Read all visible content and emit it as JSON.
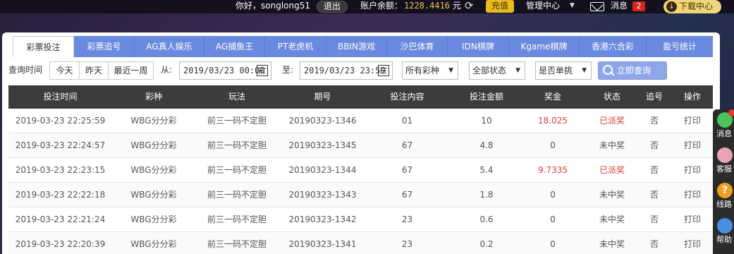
{
  "topbar": {
    "greeting": "你好，songlong51",
    "logout": "退出",
    "balance_label": "账户余额：",
    "balance": "1228.4416",
    "unit": "元",
    "recharge": "充值",
    "management": "管理中心",
    "messages_label": "消息",
    "messages_count": "2",
    "download": "下载中心"
  },
  "tabs": [
    "彩票投注",
    "彩票追号",
    "AG真人娱乐",
    "AG捕鱼王",
    "PT老虎机",
    "BBIN游戏",
    "沙巴体育",
    "IDN棋牌",
    "Kgame棋牌",
    "香港六合彩",
    "盈亏统计"
  ],
  "filters": {
    "query_time_label": "查询时间",
    "today": "今天",
    "yesterday": "昨天",
    "last_week": "最近一周",
    "from_label": "从:",
    "from_value": "2019/03/23 00:00",
    "to_label": "至:",
    "to_value": "2019/03/23 23:59",
    "lottery_select": "所有彩种",
    "status_select": "全部状态",
    "single_select": "是否单挑",
    "query_button": "立即查询"
  },
  "table": {
    "headers": [
      "投注时间",
      "彩种",
      "玩法",
      "期号",
      "投注内容",
      "投注金额",
      "奖金",
      "状态",
      "追号",
      "操作"
    ],
    "rows": [
      [
        "2019-03-23 22:25:59",
        "WBG分分彩",
        "前三一码不定胆",
        "20190323-1346",
        "01",
        "10",
        "18.025",
        "已派奖",
        "否",
        "打印"
      ],
      [
        "2019-03-23 22:24:57",
        "WBG分分彩",
        "前三一码不定胆",
        "20190323-1345",
        "67",
        "4.8",
        "0",
        "未中奖",
        "否",
        "打印"
      ],
      [
        "2019-03-23 22:23:15",
        "WBG分分彩",
        "前三一码不定胆",
        "20190323-1344",
        "67",
        "5.4",
        "9.7335",
        "已派奖",
        "否",
        "打印"
      ],
      [
        "2019-03-23 22:22:18",
        "WBG分分彩",
        "前三一码不定胆",
        "20190323-1343",
        "67",
        "1.8",
        "0",
        "未中奖",
        "否",
        "打印"
      ],
      [
        "2019-03-23 22:21:24",
        "WBG分分彩",
        "前三一码不定胆",
        "20190323-1342",
        "23",
        "0.6",
        "0",
        "未中奖",
        "否",
        "打印"
      ],
      [
        "2019-03-23 22:20:39",
        "WBG分分彩",
        "前三一码不定胆",
        "20190323-1341",
        "23",
        "0.2",
        "0",
        "未中奖",
        "否",
        "打印"
      ]
    ]
  },
  "sidebar": {
    "items": [
      {
        "label": "消息",
        "icon": "chat-icon",
        "color": "#4cc35a"
      },
      {
        "label": "客服",
        "icon": "support-icon",
        "color": "#e9a3b3"
      },
      {
        "label": "线路",
        "icon": "question-icon",
        "color": "#f0a020"
      },
      {
        "label": "帮助",
        "icon": "help-icon",
        "color": "#4a90e2"
      }
    ]
  },
  "colors": {
    "tab_bg": "#6a8ae0",
    "table_header_bg": "#3c3c3c",
    "win_text": "#e0403a",
    "recharge_bg": "#e8b920",
    "download_bg": "#f1d57a"
  }
}
